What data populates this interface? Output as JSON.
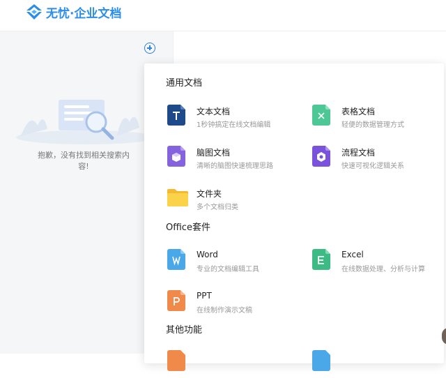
{
  "header": {
    "brand": "无忧·企业文档"
  },
  "sidebar": {
    "empty_message": "抱歉，没有找到相关搜索内容!"
  },
  "menu": {
    "sections": [
      {
        "title": "通用文档",
        "items": [
          {
            "title": "文本文档",
            "desc": "1秒钟搞定在线文档编辑",
            "icon": "text-doc-icon",
            "color": "#1f4a8a"
          },
          {
            "title": "表格文档",
            "desc": "轻便的数据管理方式",
            "icon": "sheet-doc-icon",
            "color": "#4cc795"
          },
          {
            "title": "脑图文档",
            "desc": "清晰的脑图快速梳理思路",
            "icon": "mindmap-doc-icon",
            "color": "#8563df"
          },
          {
            "title": "流程文档",
            "desc": "快速可视化逻辑关系",
            "icon": "flow-doc-icon",
            "color": "#7a53dc"
          },
          {
            "title": "文件夹",
            "desc": "多个文档归类",
            "icon": "folder-icon",
            "color": "#f9c93c"
          }
        ]
      },
      {
        "title": "Office套件",
        "items": [
          {
            "title": "Word",
            "desc": "专业的文档编辑工具",
            "icon": "word-icon",
            "color": "#4aa8e8",
            "letter": "W"
          },
          {
            "title": "Excel",
            "desc": "在线数据处理、分析与计算",
            "icon": "excel-icon",
            "color": "#3dbb85",
            "letter": "E"
          },
          {
            "title": "PPT",
            "desc": "在线制作演示文稿",
            "icon": "ppt-icon",
            "color": "#f08a4b",
            "letter": "P"
          }
        ]
      },
      {
        "title": "其他功能",
        "items": [
          {
            "title": "",
            "desc": "",
            "icon": "template-icon",
            "color": "#f08a4b"
          },
          {
            "title": "",
            "desc": "",
            "icon": "upload-icon",
            "color": "#4aa8e8"
          }
        ]
      }
    ]
  },
  "colors": {
    "brand": "#2a8ee9",
    "accent": "#2d7fe0"
  }
}
